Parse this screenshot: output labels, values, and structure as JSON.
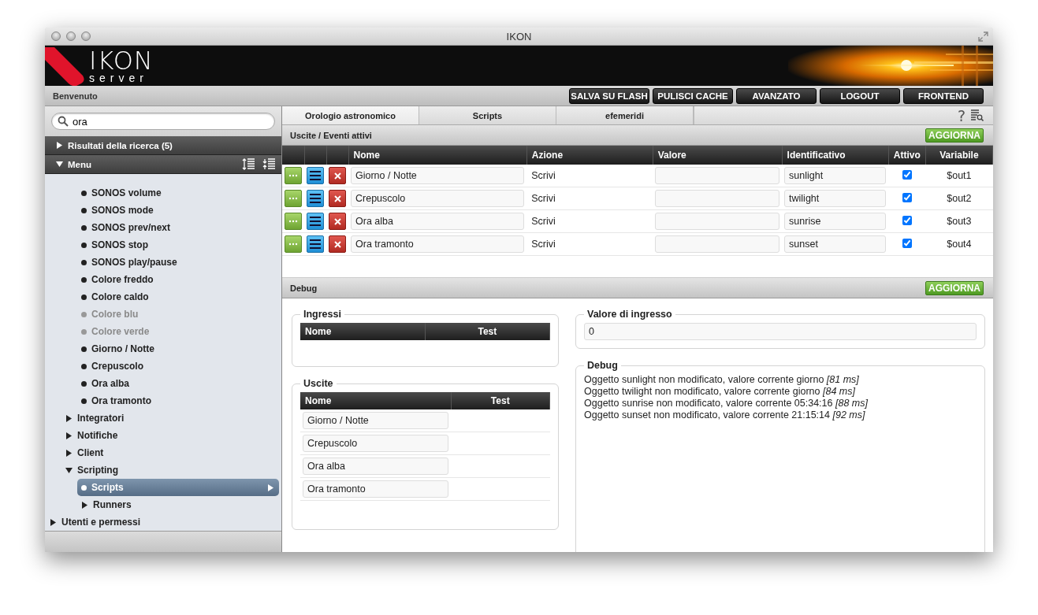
{
  "window": {
    "title": "IKON"
  },
  "logo": {
    "name": "IKON",
    "subtitle": "server"
  },
  "toolbar": {
    "greeting": "Benvenuto",
    "buttons": [
      "SALVA SU FLASH",
      "PULISCI CACHE",
      "AVANZATO",
      "LOGOUT",
      "FRONTEND"
    ]
  },
  "sidebar": {
    "search": {
      "value": "ora"
    },
    "sections": [
      {
        "label": "Risultati della ricerca (5)",
        "expanded": false
      },
      {
        "label": "Menu",
        "expanded": true
      }
    ],
    "tree": [
      {
        "children": [
          {
            "children": [
              {
                "label": "SONOS volume",
                "kind": "leaf",
                "disabled": false,
                "selected": false
              },
              {
                "label": "SONOS mode",
                "kind": "leaf",
                "disabled": false,
                "selected": false
              },
              {
                "label": "SONOS prev/next",
                "kind": "leaf",
                "disabled": false,
                "selected": false
              },
              {
                "label": "SONOS stop",
                "kind": "leaf",
                "disabled": false,
                "selected": false
              },
              {
                "label": "SONOS play/pause",
                "kind": "leaf",
                "disabled": false,
                "selected": false
              },
              {
                "label": "Colore freddo",
                "kind": "leaf",
                "disabled": false,
                "selected": false
              },
              {
                "label": "Colore caldo",
                "kind": "leaf",
                "disabled": false,
                "selected": false
              },
              {
                "label": "Colore blu",
                "kind": "leaf",
                "disabled": true,
                "selected": false
              },
              {
                "label": "Colore verde",
                "kind": "leaf",
                "disabled": true,
                "selected": false
              },
              {
                "label": "Giorno / Notte",
                "kind": "leaf",
                "disabled": false,
                "selected": false
              },
              {
                "label": "Crepuscolo",
                "kind": "leaf",
                "disabled": false,
                "selected": false
              },
              {
                "label": "Ora alba",
                "kind": "leaf",
                "disabled": false,
                "selected": false
              },
              {
                "label": "Ora tramonto",
                "kind": "leaf",
                "disabled": false,
                "selected": false
              }
            ]
          },
          {
            "label": "Integratori",
            "kind": "branch",
            "expanded": false,
            "selected": false
          },
          {
            "label": "Notifiche",
            "kind": "branch",
            "expanded": false,
            "selected": false
          },
          {
            "label": "Client",
            "kind": "branch",
            "expanded": false,
            "selected": false
          },
          {
            "label": "Scripting",
            "kind": "branch",
            "expanded": true,
            "selected": false,
            "children": [
              {
                "label": "Scripts",
                "kind": "leaf",
                "disabled": false,
                "selected": true
              },
              {
                "label": "Runners",
                "kind": "branch",
                "expanded": false,
                "selected": false
              }
            ]
          }
        ]
      },
      {
        "label": "Utenti e permessi",
        "kind": "branch",
        "expanded": false,
        "selected": false
      }
    ]
  },
  "tabs": [
    {
      "label": "Orologio astronomico",
      "selected": true
    },
    {
      "label": "Scripts",
      "selected": false
    },
    {
      "label": "efemeridi",
      "selected": false
    }
  ],
  "help": "?",
  "outputs": {
    "title": "Uscite / Eventi attivi",
    "refresh": "AGGIORNA",
    "columns": [
      "Nome",
      "Azione",
      "Valore",
      "Identificativo",
      "Attivo",
      "Variabile"
    ],
    "rows": [
      {
        "name": "Giorno / Notte",
        "action": "Scrivi",
        "identifier": "sunlight",
        "active": true,
        "variable": "$out1"
      },
      {
        "name": "Crepuscolo",
        "action": "Scrivi",
        "identifier": "twilight",
        "active": true,
        "variable": "$out2"
      },
      {
        "name": "Ora alba",
        "action": "Scrivi",
        "identifier": "sunrise",
        "active": true,
        "variable": "$out3"
      },
      {
        "name": "Ora tramonto",
        "action": "Scrivi",
        "identifier": "sunset",
        "active": true,
        "variable": "$out4"
      }
    ]
  },
  "debug": {
    "title": "Debug",
    "refresh": "AGGIORNA",
    "inputs": {
      "legend": "Ingressi",
      "columns": [
        "Nome",
        "Test"
      ]
    },
    "outputs": {
      "legend": "Uscite",
      "columns": [
        "Nome",
        "Test"
      ],
      "rows": [
        "Giorno / Notte",
        "Crepuscolo",
        "Ora alba",
        "Ora tramonto"
      ]
    },
    "input_value": {
      "legend": "Valore di ingresso",
      "value": "0"
    },
    "log": {
      "legend": "Debug",
      "lines": [
        "Oggetto sunlight non modificato, valore corrente giorno *[81 ms]*",
        "Oggetto twilight non modificato, valore corrente giorno *[84 ms]*",
        "Oggetto sunrise non modificato, valore corrente 05:34:16 *[88 ms]*",
        "Oggetto sunset non modificato, valore corrente 21:15:14 *[92 ms]*"
      ]
    }
  }
}
